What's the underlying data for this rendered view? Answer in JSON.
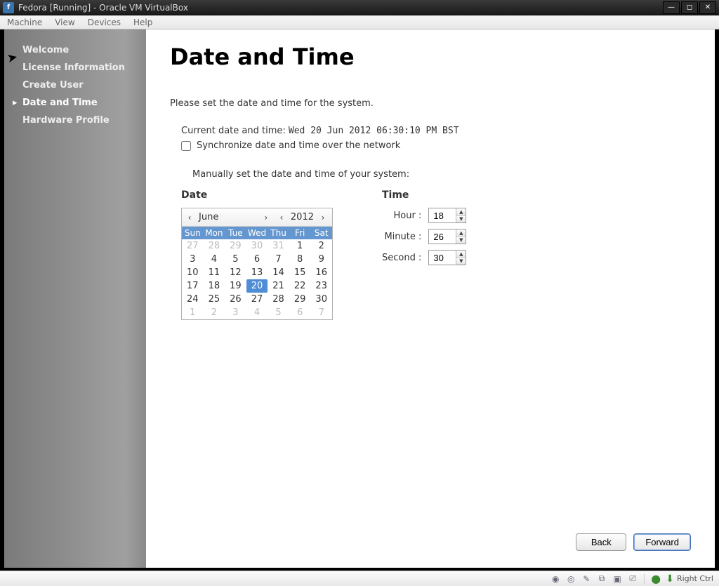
{
  "window": {
    "title": "Fedora [Running] - Oracle VM VirtualBox"
  },
  "menubar": [
    "Machine",
    "View",
    "Devices",
    "Help"
  ],
  "sidebar": {
    "items": [
      {
        "label": "Welcome",
        "active": false
      },
      {
        "label": "License Information",
        "active": false
      },
      {
        "label": "Create User",
        "active": false
      },
      {
        "label": "Date and Time",
        "active": true
      },
      {
        "label": "Hardware Profile",
        "active": false
      }
    ]
  },
  "page": {
    "title": "Date and Time",
    "instruction": "Please set the date and time for the system.",
    "current_label": "Current date and time:",
    "current_value": "Wed 20 Jun 2012 06:30:10 PM BST",
    "sync_label": "Synchronize date and time over the network",
    "sync_checked": false,
    "manual_label": "Manually set the date and time of your system:"
  },
  "date": {
    "heading": "Date",
    "month": "June",
    "year": "2012",
    "dow": [
      "Sun",
      "Mon",
      "Tue",
      "Wed",
      "Thu",
      "Fri",
      "Sat"
    ],
    "cells": [
      {
        "n": "27",
        "other": true
      },
      {
        "n": "28",
        "other": true
      },
      {
        "n": "29",
        "other": true
      },
      {
        "n": "30",
        "other": true
      },
      {
        "n": "31",
        "other": true
      },
      {
        "n": "1"
      },
      {
        "n": "2"
      },
      {
        "n": "3"
      },
      {
        "n": "4"
      },
      {
        "n": "5"
      },
      {
        "n": "6"
      },
      {
        "n": "7"
      },
      {
        "n": "8"
      },
      {
        "n": "9"
      },
      {
        "n": "10"
      },
      {
        "n": "11"
      },
      {
        "n": "12"
      },
      {
        "n": "13"
      },
      {
        "n": "14"
      },
      {
        "n": "15"
      },
      {
        "n": "16"
      },
      {
        "n": "17"
      },
      {
        "n": "18"
      },
      {
        "n": "19"
      },
      {
        "n": "20",
        "selected": true
      },
      {
        "n": "21"
      },
      {
        "n": "22"
      },
      {
        "n": "23"
      },
      {
        "n": "24"
      },
      {
        "n": "25"
      },
      {
        "n": "26"
      },
      {
        "n": "27"
      },
      {
        "n": "28"
      },
      {
        "n": "29"
      },
      {
        "n": "30"
      },
      {
        "n": "1",
        "other": true
      },
      {
        "n": "2",
        "other": true
      },
      {
        "n": "3",
        "other": true
      },
      {
        "n": "4",
        "other": true
      },
      {
        "n": "5",
        "other": true
      },
      {
        "n": "6",
        "other": true
      },
      {
        "n": "7",
        "other": true
      }
    ]
  },
  "time": {
    "heading": "Time",
    "hour_label": "Hour :",
    "minute_label": "Minute :",
    "second_label": "Second :",
    "hour": "18",
    "minute": "26",
    "second": "30"
  },
  "buttons": {
    "back": "Back",
    "forward": "Forward"
  },
  "statusbar": {
    "host_key": "Right Ctrl"
  }
}
